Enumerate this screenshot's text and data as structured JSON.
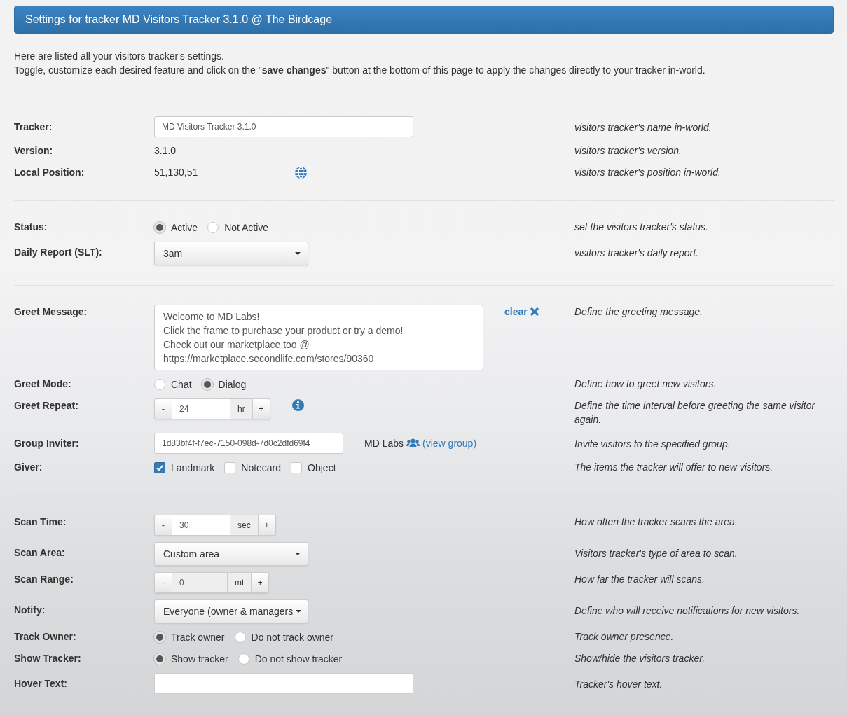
{
  "header": {
    "title": "Settings for tracker MD Visitors Tracker 3.1.0 @ The Birdcage"
  },
  "intro": [
    "Here are listed all your visitors tracker's settings.",
    "Toggle, customize each desired feature and click on the \"**save changes**\" button at the bottom of this page to apply the changes directly to your tracker in-world."
  ],
  "sections": [
    {
      "rows": [
        {
          "kind": "input",
          "label": "Tracker:",
          "value": "MD Visitors Tracker 3.1.0",
          "help": "visitors tracker's name in-world."
        },
        {
          "kind": "text",
          "label": "Version:",
          "value": "3.1.0",
          "help": "visitors tracker's version."
        },
        {
          "kind": "position",
          "label": "Local Position:",
          "value": "51,130,51",
          "help": "visitors tracker's position in-world."
        }
      ]
    },
    {
      "rows": [
        {
          "kind": "radio",
          "label": "Status:",
          "options": [
            {
              "label": "Active",
              "selected": true
            },
            {
              "label": "Not Active",
              "selected": false
            }
          ],
          "help": "set the visitors tracker's status."
        },
        {
          "kind": "select",
          "label": "Daily Report (SLT):",
          "value": "3am",
          "help": "visitors tracker's daily report."
        }
      ]
    },
    {
      "rows": [
        {
          "kind": "textarea",
          "label": "Greet Message:",
          "value": "Welcome to MD Labs!\nClick the frame to purchase your product or try a demo!\nCheck out our marketplace too @\nhttps://marketplace.secondlife.com/stores/90360",
          "action": "clear",
          "help": "Define the greeting message."
        },
        {
          "kind": "radio",
          "label": "Greet Mode:",
          "options": [
            {
              "label": "Chat",
              "selected": false
            },
            {
              "label": "Dialog",
              "selected": true
            }
          ],
          "help": "Define how to greet new visitors."
        },
        {
          "kind": "spinner",
          "label": "Greet Repeat:",
          "minus": "-",
          "value": "24",
          "unit": "hr",
          "plus": "+",
          "disabled": false,
          "info": true,
          "help": "Define the time interval before greeting the same visitor again."
        },
        {
          "kind": "group",
          "label": "Group Inviter:",
          "value": "1d83bf4f-f7ec-7150-098d-7d0c2dfd69f4",
          "group_name": "MD Labs",
          "link": "(view group)",
          "help": "Invite visitors to the specified group."
        },
        {
          "kind": "checkbox",
          "label": "Giver:",
          "options": [
            {
              "label": "Landmark",
              "checked": true
            },
            {
              "label": "Notecard",
              "checked": false
            },
            {
              "label": "Object",
              "checked": false
            }
          ],
          "help": "The items the tracker will offer to new visitors."
        }
      ]
    },
    {
      "rows": [
        {
          "kind": "spinner",
          "label": "Scan Time:",
          "minus": "-",
          "value": "30",
          "unit": "sec",
          "plus": "+",
          "disabled": false,
          "info": false,
          "help": "How often the tracker scans the area."
        },
        {
          "kind": "select",
          "label": "Scan Area:",
          "value": "Custom area",
          "help": "Visitors tracker's type of area to scan."
        },
        {
          "kind": "spinner",
          "label": "Scan Range:",
          "minus": "-",
          "value": "0",
          "unit": "mt",
          "plus": "+",
          "disabled": true,
          "info": false,
          "help": "How far the tracker will scans."
        },
        {
          "kind": "select",
          "label": "Notify:",
          "value": "Everyone (owner & managers",
          "help": "Define who will receive notifications for new visitors."
        },
        {
          "kind": "radio",
          "label": "Track Owner:",
          "options": [
            {
              "label": "Track owner",
              "selected": true
            },
            {
              "label": "Do not track owner",
              "selected": false
            }
          ],
          "help": "Track owner presence."
        },
        {
          "kind": "radio",
          "label": "Show Tracker:",
          "options": [
            {
              "label": "Show tracker",
              "selected": true
            },
            {
              "label": "Do not show tracker",
              "selected": false
            }
          ],
          "help": "Show/hide the visitors tracker."
        },
        {
          "kind": "input",
          "label": "Hover Text:",
          "help": "Tracker's hover text."
        }
      ]
    }
  ]
}
